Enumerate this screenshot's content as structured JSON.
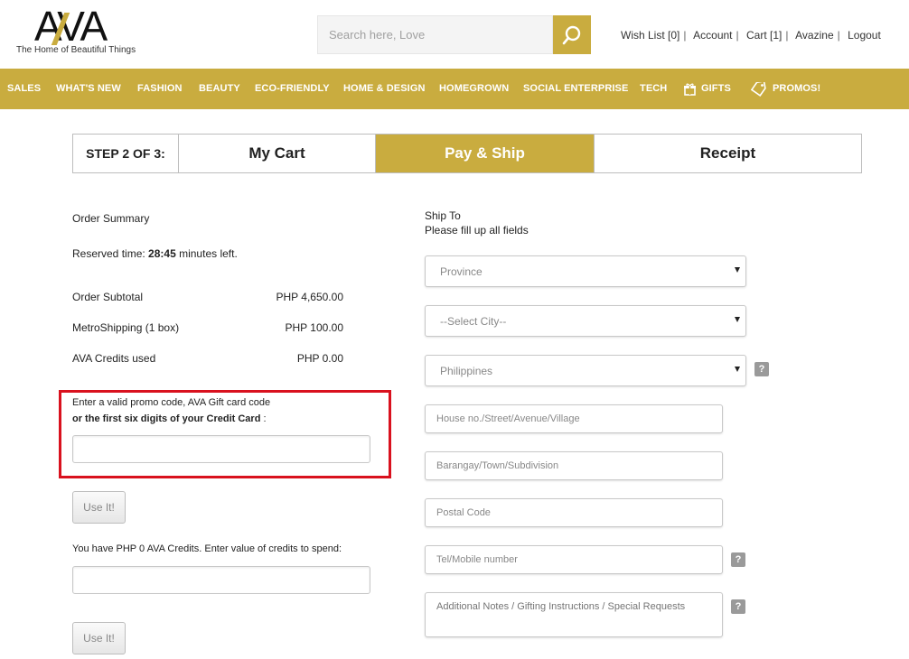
{
  "brand": {
    "logo_text": "AVA",
    "tagline": "The Home of Beautiful Things",
    "accent_color": "#c9ac3f"
  },
  "search": {
    "placeholder": "Search here, Love",
    "icon": "search-icon"
  },
  "top_links": {
    "wishlist": "Wish List [0]",
    "account": "Account",
    "cart": "Cart [1]",
    "avazine": "Avazine",
    "logout": "Logout",
    "separator": "|"
  },
  "nav": {
    "items": [
      {
        "label": "SALES"
      },
      {
        "label": "WHAT'S NEW"
      },
      {
        "label": "FASHION"
      },
      {
        "label": "BEAUTY"
      },
      {
        "label": "ECO-FRIENDLY"
      },
      {
        "label": "HOME & DESIGN"
      },
      {
        "label": "HOMEGROWN"
      },
      {
        "label": "SOCIAL ENTERPRISE"
      },
      {
        "label": "TECH"
      },
      {
        "label": "GIFTS",
        "icon": "gift-icon"
      },
      {
        "label": "PROMOS!",
        "icon": "tag-icon"
      }
    ]
  },
  "steps": {
    "label": "STEP 2 OF 3:",
    "items": [
      {
        "label": "My Cart"
      },
      {
        "label": "Pay & Ship",
        "active": true
      },
      {
        "label": "Receipt"
      }
    ]
  },
  "order": {
    "summary_title": "Order Summary",
    "reserved_prefix": "Reserved time:",
    "reserved_time": "28:45",
    "reserved_suffix": "minutes left.",
    "lines": [
      {
        "label": "Order Subtotal",
        "amount": "PHP 4,650.00"
      },
      {
        "label": "MetroShipping (1 box)",
        "amount": "PHP 100.00"
      },
      {
        "label": "AVA Credits used",
        "amount": "PHP 0.00"
      }
    ]
  },
  "promo": {
    "line1": "Enter a valid promo code, AVA Gift card code",
    "line2": "or the first six digits of your Credit Card",
    "line2_suffix": " :",
    "value": "",
    "button": "Use It!"
  },
  "credits": {
    "text": "You have PHP 0 AVA Credits. Enter value of credits to spend:",
    "value": "",
    "button": "Use It!"
  },
  "ship": {
    "title": "Ship To",
    "subtitle": "Please fill up all fields",
    "province": "Province",
    "city": "--Select City--",
    "country": "Philippines",
    "address": "House no./Street/Avenue/Village",
    "barangay": "Barangay/Town/Subdivision",
    "postal": "Postal Code",
    "phone": "Tel/Mobile number",
    "notes": "Additional Notes / Gifting Instructions / Special Requests",
    "help": "?"
  }
}
